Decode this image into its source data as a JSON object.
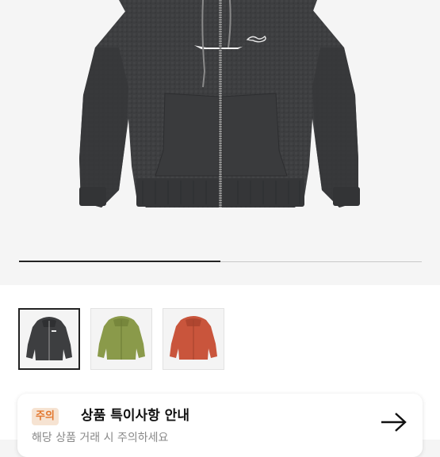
{
  "gallery": {
    "progress": 0.5,
    "thumbnails": [
      {
        "name": "thumb-charcoal-hoodie",
        "color": "#3d3e40",
        "selected": true
      },
      {
        "name": "thumb-olive-hoodie",
        "color": "#8a9a4a",
        "selected": false
      },
      {
        "name": "thumb-red-hoodie",
        "color": "#c9553c",
        "selected": false
      }
    ],
    "logo_text": "Stüssy"
  },
  "notice": {
    "badge": "주의",
    "title": "상품 특이사항 안내",
    "subtitle": "해당 상품 거래 시 주의하세요",
    "arrow_icon": "arrow-right-icon"
  },
  "colors": {
    "hoodie_main": "#3d3e40",
    "accent": "#e2762d",
    "badge_bg": "#f6e3d2"
  }
}
